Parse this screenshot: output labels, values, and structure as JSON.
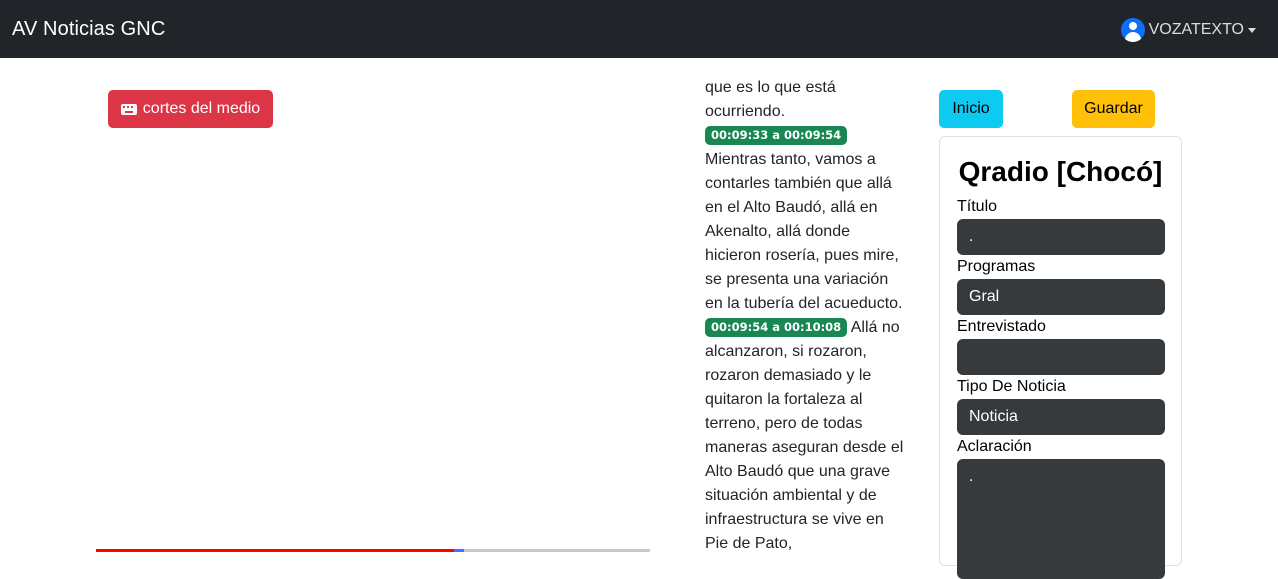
{
  "navbar": {
    "brand": "AV Noticias GNC",
    "user_name": "VOZATEXTO",
    "user_icon": "user-circle-icon",
    "caret_icon": "caret-down-icon"
  },
  "left": {
    "cortes_button_label": "cortes del medio",
    "cortes_icon": "keyboard-icon",
    "playback_progress_percent": 64.6
  },
  "transcript": {
    "lead_text": "que es lo que está ocurriendo.",
    "segments": [
      {
        "timestamp": "00:09:33 a 00:09:54",
        "text": "Mientras tanto, vamos a contarles también que allá en el Alto Baudó, allá en Akenalto, allá donde hicieron rosería, pues mire, se presenta una variación en la tubería del acueducto."
      },
      {
        "timestamp": "00:09:54 a 00:10:08",
        "text": "Allá no alcanzaron, si rozaron, rozaron demasiado y le quitaron la fortaleza al terreno, pero de todas maneras aseguran desde el Alto Baudó que una grave situación ambiental y de infraestructura se vive en Pie de Pato,"
      }
    ]
  },
  "actions": {
    "inicio_label": "Inicio",
    "guardar_label": "Guardar"
  },
  "form": {
    "title": "Qradio [Chocó]",
    "titulo_label": "Título",
    "titulo_value": ".",
    "programas_label": "Programas",
    "programas_value": "Gral",
    "entrevistado_label": "Entrevistado",
    "entrevistado_value": "",
    "tipo_label": "Tipo De Noticia",
    "tipo_value": "Noticia",
    "aclaracion_label": "Aclaración",
    "aclaracion_value": "."
  },
  "colors": {
    "navbar_bg": "#212529",
    "danger": "#dc3545",
    "success": "#198754",
    "info": "#0dcaf0",
    "warning": "#ffc107",
    "field_bg": "#373a3c"
  }
}
